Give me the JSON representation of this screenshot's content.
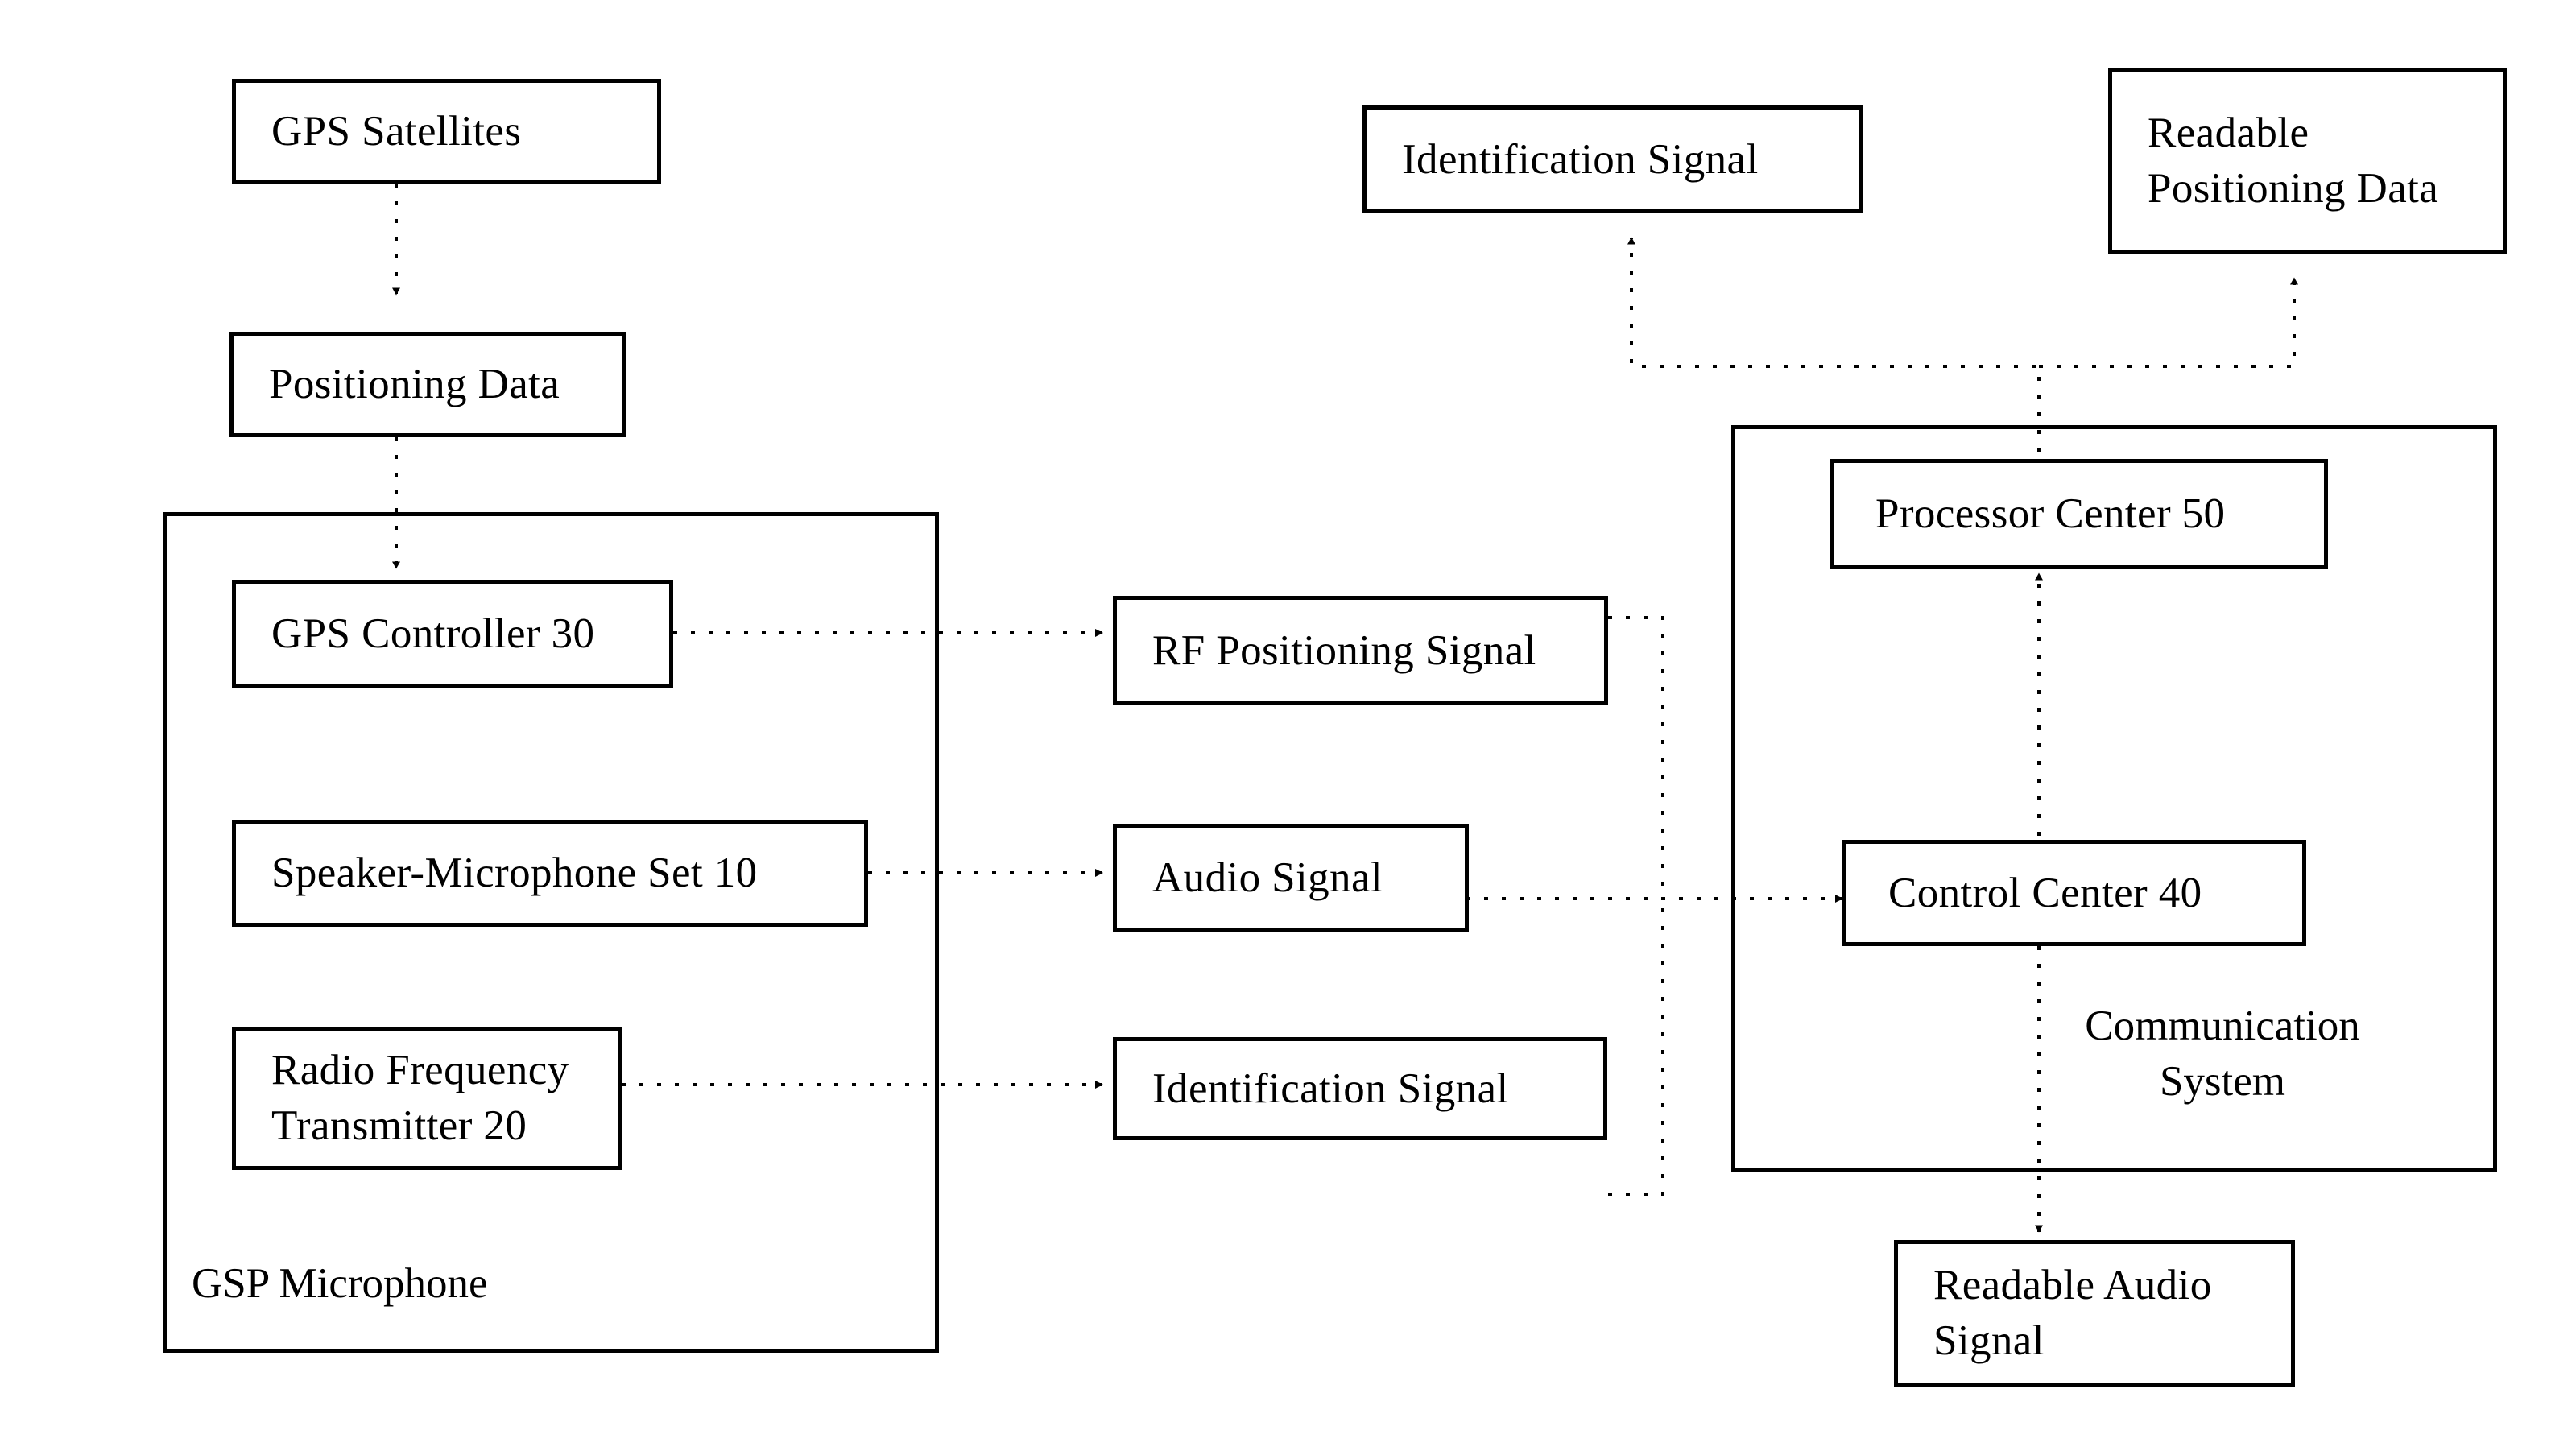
{
  "figure": {
    "type": "patent-block-diagram",
    "background_color": "#ffffff",
    "line_color": "#000000"
  },
  "nodes": {
    "gps_satellites": {
      "label": "GPS Satellites"
    },
    "positioning_data": {
      "label": "Positioning Data"
    },
    "gps_controller": {
      "label": "GPS Controller 30"
    },
    "speaker_microphone_set": {
      "label": "Speaker-Microphone Set 10"
    },
    "radio_frequency_transmitter": {
      "label": "Radio Frequency\nTransmitter 20"
    },
    "rf_positioning_signal": {
      "label": "RF Positioning Signal"
    },
    "audio_signal": {
      "label": "Audio Signal"
    },
    "identification_signal_mid": {
      "label": "Identification Signal"
    },
    "identification_signal_top": {
      "label": "Identification Signal"
    },
    "readable_positioning_data": {
      "label": "Readable\nPositioning Data"
    },
    "processor_center": {
      "label": "Processor Center 50"
    },
    "control_center": {
      "label": "Control Center 40"
    },
    "readable_audio_signal": {
      "label": "Readable Audio\nSignal"
    }
  },
  "groups": {
    "gsp_microphone": {
      "label": "GSP Microphone"
    },
    "communication_system": {
      "label": "Communication\nSystem"
    }
  },
  "connections": [
    {
      "from": "gps_satellites",
      "to": "positioning_data",
      "style": "dotted",
      "arrow": "down"
    },
    {
      "from": "positioning_data",
      "to": "gps_controller",
      "style": "dotted",
      "arrow": "down"
    },
    {
      "from": "gps_controller",
      "to": "rf_positioning_signal",
      "style": "dotted",
      "arrow": "right"
    },
    {
      "from": "speaker_microphone_set",
      "to": "audio_signal",
      "style": "dotted",
      "arrow": "right"
    },
    {
      "from": "radio_frequency_transmitter",
      "to": "identification_signal_mid",
      "style": "dotted",
      "arrow": "right"
    },
    {
      "from": "rf_positioning_signal",
      "to": "control_center",
      "style": "dotted",
      "arrow": "right"
    },
    {
      "from": "audio_signal",
      "to": "control_center",
      "style": "dotted",
      "arrow": "right"
    },
    {
      "from": "identification_signal_mid",
      "to": "control_center",
      "style": "dotted",
      "arrow": "right"
    },
    {
      "from": "control_center",
      "to": "processor_center",
      "style": "dotted",
      "arrow": "up"
    },
    {
      "from": "control_center",
      "to": "readable_audio_signal",
      "style": "dotted",
      "arrow": "down"
    },
    {
      "from": "processor_center",
      "to": "identification_signal_top",
      "style": "dotted",
      "arrow": "up"
    },
    {
      "from": "processor_center",
      "to": "readable_positioning_data",
      "style": "dotted",
      "arrow": "up"
    }
  ]
}
